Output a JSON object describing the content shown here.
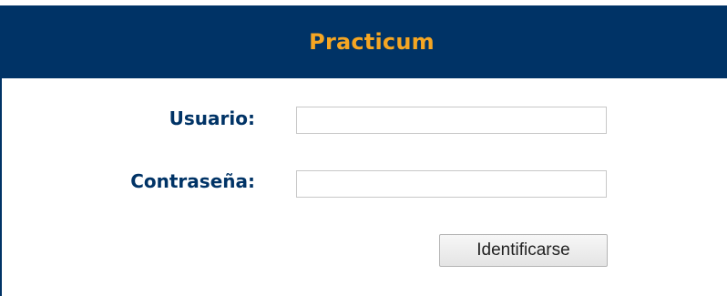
{
  "header": {
    "title": "Practicum"
  },
  "form": {
    "username_label": "Usuario:",
    "username_value": "",
    "password_label": "Contraseña:",
    "password_value": "",
    "submit_label": "Identificarse"
  },
  "colors": {
    "header_background": "#003366",
    "title_accent": "#f5a623",
    "label_text": "#003366"
  }
}
